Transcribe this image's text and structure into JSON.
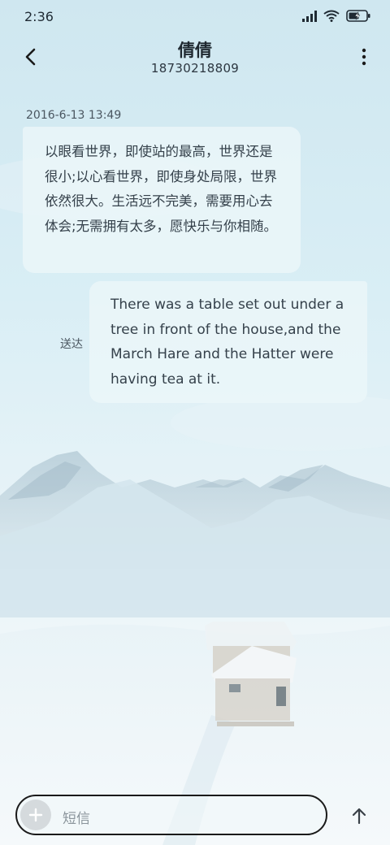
{
  "status_bar": {
    "time": "2:36"
  },
  "header": {
    "contact_name": "倩倩",
    "contact_number": "18730218809"
  },
  "conversation": {
    "timestamp": "2016-6-13 13:49",
    "incoming": {
      "text": "以眼看世界，即使站的最高，世界还是很小;以心看世界，即使身处局限，世界依然很大。生活远不完美，需要用心去体会;无需拥有太多，愿快乐与你相随。"
    },
    "outgoing": {
      "text": "There was a table set out under a tree in front of the house,and the March Hare and the Hatter were having tea at it.",
      "status": "送达"
    }
  },
  "composer": {
    "placeholder": "短信"
  },
  "icons": {
    "back": "back-arrow-icon",
    "more": "more-vertical-icon",
    "add": "plus-icon",
    "send": "arrow-up-icon",
    "signal": "signal-icon",
    "wifi": "wifi-icon",
    "battery": "battery-charging-icon"
  }
}
